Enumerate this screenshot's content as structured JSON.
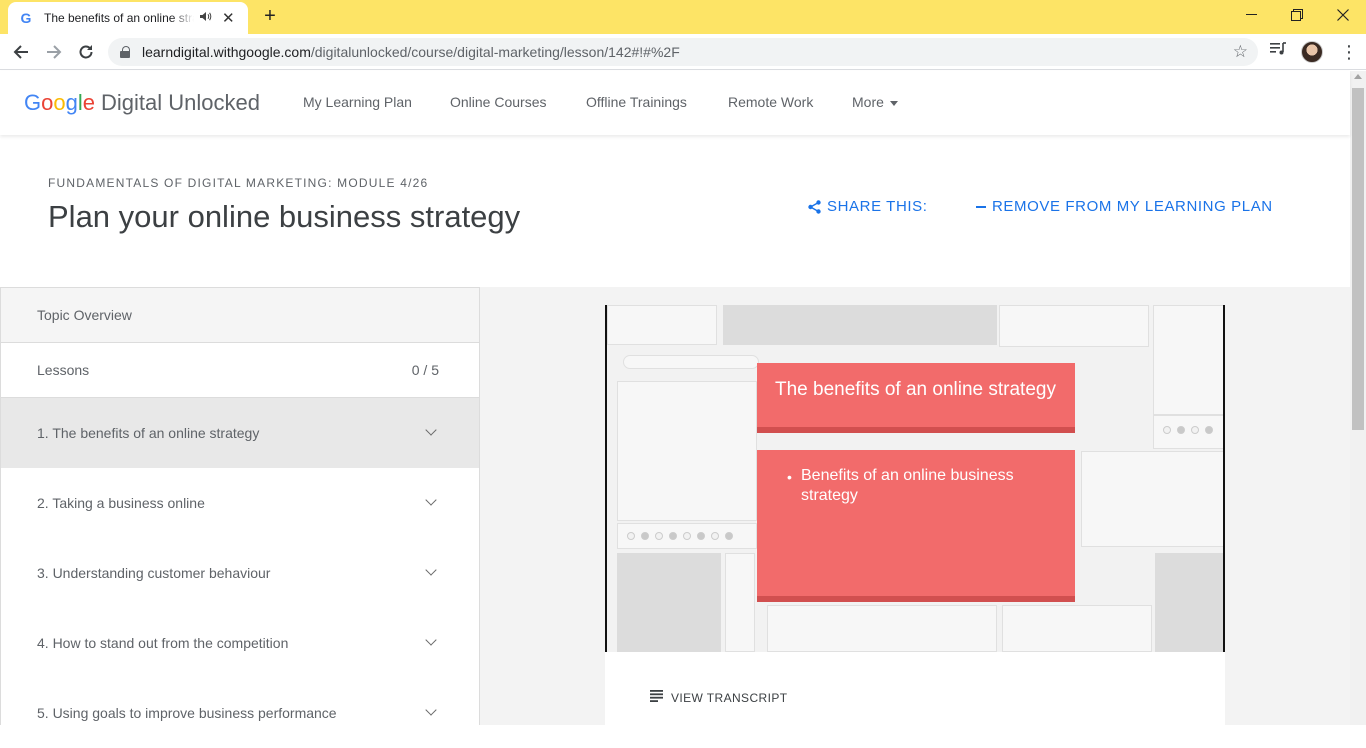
{
  "browser": {
    "tab_title": "The benefits of an online strategy",
    "url_host": "learndigital.withgoogle.com",
    "url_path": "/digitalunlocked/course/digital-marketing/lesson/142#!#%2F"
  },
  "header": {
    "logo_google": [
      "G",
      "o",
      "o",
      "g",
      "l",
      "e"
    ],
    "logo_product": "Digital Unlocked",
    "nav": [
      "My Learning Plan",
      "Online Courses",
      "Offline Trainings",
      "Remote Work",
      "More"
    ]
  },
  "page": {
    "kicker": "FUNDAMENTALS OF DIGITAL MARKETING: MODULE 4/26",
    "title": "Plan your online business strategy",
    "share_label": "SHARE THIS:",
    "remove_label": "REMOVE FROM MY LEARNING PLAN"
  },
  "sidebar": {
    "overview_label": "Topic Overview",
    "lessons_label": "Lessons",
    "lessons_progress": "0 / 5",
    "lessons": [
      "1. The benefits of an online strategy",
      "2. Taking a business online",
      "3. Understanding customer behaviour",
      "4. How to stand out from the competition",
      "5. Using goals to improve business performance"
    ]
  },
  "video": {
    "card_title": "The benefits of an online strategy",
    "card_bullet": "Benefits of an online business strategy"
  },
  "transcript": {
    "label": "VIEW TRANSCRIPT"
  },
  "colors": {
    "tabbar": "#fde466",
    "accent": "#1a73e8",
    "card": "#f26b6b"
  }
}
